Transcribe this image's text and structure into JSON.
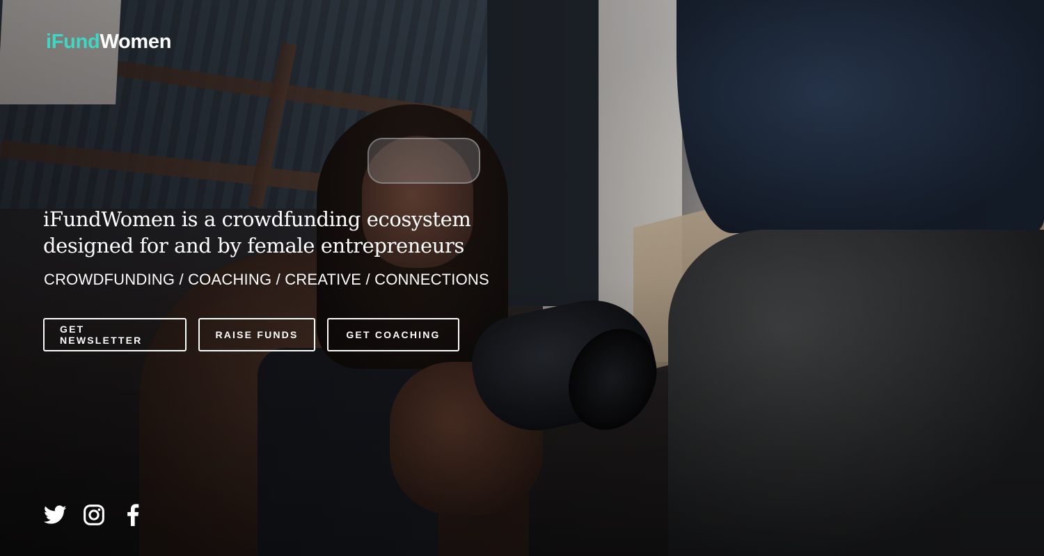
{
  "header": {
    "logo_prefix": "i",
    "logo_accent": "Fund",
    "logo_suffix": "Women",
    "logo_accent_color": "#3fd7c3"
  },
  "hero": {
    "headline_line1": "iFundWomen is a crowdfunding ecosystem",
    "headline_line2": "designed for and by female entrepreneurs",
    "tagline": "CROWDFUNDING / COACHING / CREATIVE / CONNECTIONS"
  },
  "actions": {
    "newsletter_label": "GET NEWSLETTER",
    "raise_funds_label": "RAISE FUNDS",
    "coaching_label": "GET COACHING"
  },
  "social": {
    "items": [
      {
        "icon": "twitter-icon"
      },
      {
        "icon": "instagram-icon"
      },
      {
        "icon": "facebook-icon"
      }
    ]
  },
  "colors": {
    "text": "#ffffff",
    "accent": "#3fd7c3"
  }
}
